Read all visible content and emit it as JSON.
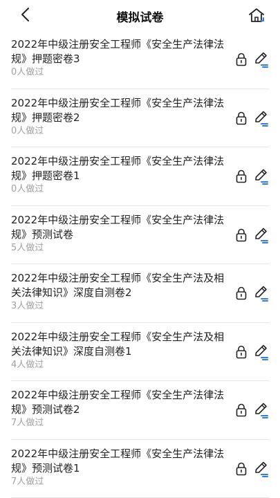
{
  "header": {
    "title": "模拟试卷",
    "back_icon": "chevron-left-icon",
    "home_icon": "home-icon"
  },
  "colors": {
    "accent": "#2f7bea",
    "text": "#222222",
    "meta": "#a0a0a0",
    "divider": "#e6e6e6"
  },
  "exams": [
    {
      "title": "2022年中级注册安全工程师《安全生产法律法规》押题密卷3",
      "done": "0人做过"
    },
    {
      "title": "2022年中级注册安全工程师《安全生产法律法规》押题密卷2",
      "done": "0人做过"
    },
    {
      "title": "2022年中级注册安全工程师《安全生产法律法规》押题密卷1",
      "done": "0人做过"
    },
    {
      "title": "2022年中级注册安全工程师《安全生产法律法规》预测试卷",
      "done": "5人做过"
    },
    {
      "title": "2022年中级注册安全工程师《安全生产法及相关法律知识》深度自测卷2",
      "done": "3人做过"
    },
    {
      "title": "2022年中级注册安全工程师《安全生产法及相关法律知识》深度自测卷1",
      "done": "4人做过"
    },
    {
      "title": "2022年中级注册安全工程师《安全生产法律法规》预测试卷2",
      "done": "7人做过"
    },
    {
      "title": "2022年中级注册安全工程师《安全生产法律法规》预测试卷1",
      "done": "7人做过"
    }
  ]
}
